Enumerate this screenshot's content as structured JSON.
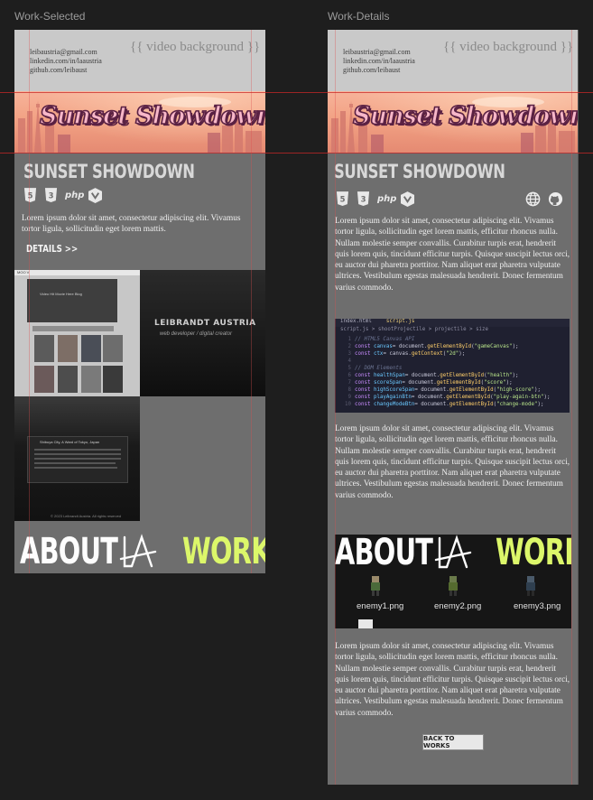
{
  "frames": [
    {
      "label": "Work-Selected",
      "contact": [
        "leibaustria@gmail.com",
        "linkedin.com/in/laaustria",
        "github.com/leibaust"
      ],
      "video_bg": "{{ video background }}",
      "banner_title": "Sunset Showdown",
      "project_title": "SUNSET SHOWDOWN",
      "tech_icons": [
        "html5-icon",
        "css3-icon",
        "php-icon",
        "redux-icon"
      ],
      "php_label": "php",
      "description": "Lorem ipsum dolor sit amet, consectetur adipiscing elit. Vivamus tortor ligula, sollicitudin eget lorem mattis.",
      "details_link": "DETAILS >>",
      "gallery": {
        "item1": {
          "menu": "MOO V",
          "hero": "Video Hit Movie Here Blog"
        },
        "item2": {
          "name": "LEIBRANDT AUSTRIA",
          "tagline": "web developer / digital creator"
        },
        "item3": {
          "title": "Shibuya City, A Ward of Tokyo, Japan",
          "footer": "© 2023 Leibrandt Austria. All rights reserved"
        }
      },
      "nav_words": {
        "about": "ABOUT",
        "work": "WORK"
      }
    },
    {
      "label": "Work-Details",
      "contact": [
        "leibaustria@gmail.com",
        "linkedin.com/in/laaustria",
        "github.com/leibaust"
      ],
      "video_bg": "{{ video background }}",
      "banner_title": "Sunset Showdown",
      "project_title": "SUNSET SHOWDOWN",
      "tech_icons": [
        "html5-icon",
        "css3-icon",
        "php-icon",
        "redux-icon"
      ],
      "php_label": "php",
      "link_icons": [
        "globe-icon",
        "github-icon"
      ],
      "paragraphs": [
        "Lorem ipsum dolor sit amet, consectetur adipiscing elit. Vivamus tortor ligula, sollicitudin eget lorem mattis, efficitur rhoncus nulla. Nullam molestie semper convallis. Curabitur turpis erat, hendrerit quis lorem quis, tincidunt efficitur turpis. Quisque suscipit lectus orci, eu auctor dui pharetra porttitor. Nam aliquet erat pharetra vulputate ultrices. Vestibulum egestas malesuada hendrerit. Donec fermentum varius commodo.",
        "Lorem ipsum dolor sit amet, consectetur adipiscing elit. Vivamus tortor ligula, sollicitudin eget lorem mattis, efficitur rhoncus nulla. Nullam molestie semper convallis. Curabitur turpis erat, hendrerit quis lorem quis, tincidunt efficitur turpis. Quisque suscipit lectus orci, eu auctor dui pharetra porttitor. Nam aliquet erat pharetra vulputate ultrices. Vestibulum egestas malesuada hendrerit. Donec fermentum varius commodo.",
        "Lorem ipsum dolor sit amet, consectetur adipiscing elit. Vivamus tortor ligula, sollicitudin eget lorem mattis, efficitur rhoncus nulla. Nullam molestie semper convallis. Curabitur turpis erat, hendrerit quis lorem quis, tincidunt efficitur turpis. Quisque suscipit lectus orci, eu auctor dui pharetra porttitor. Nam aliquet erat pharetra vulputate ultrices. Vestibulum egestas malesuada hendrerit. Donec fermentum varius commodo."
      ],
      "code": {
        "tabs": [
          "index.html",
          "script.js"
        ],
        "breadcrumb": "script.js > shootProjectile > projectile > size",
        "line_numbers": [
          "1",
          "2",
          "3",
          "4",
          "5",
          "6",
          "7",
          "8",
          "9",
          "10",
          "11"
        ],
        "lines": [
          {
            "parts": [
              [
                "cm",
                "// HTML5 Canvas API"
              ]
            ]
          },
          {
            "parts": [
              [
                "kw",
                "const "
              ],
              [
                "vr",
                "canvas"
              ],
              [
                "",
                "= document."
              ],
              [
                "fn",
                "getElementById"
              ],
              [
                "",
                "("
              ],
              [
                "st",
                "\"gameCanvas\""
              ],
              [
                "",
                ");"
              ]
            ]
          },
          {
            "parts": [
              [
                "kw",
                "const "
              ],
              [
                "vr",
                "ctx"
              ],
              [
                "",
                "= canvas."
              ],
              [
                "fn",
                "getContext"
              ],
              [
                "",
                "("
              ],
              [
                "st",
                "\"2d\""
              ],
              [
                "",
                ");"
              ]
            ]
          },
          {
            "parts": [
              [
                "",
                ""
              ]
            ]
          },
          {
            "parts": [
              [
                "cm",
                "// DOM Elements"
              ]
            ]
          },
          {
            "parts": [
              [
                "kw",
                "const "
              ],
              [
                "vr",
                "healthSpan"
              ],
              [
                "",
                "= document."
              ],
              [
                "fn",
                "getElementById"
              ],
              [
                "",
                "("
              ],
              [
                "st",
                "\"health\""
              ],
              [
                "",
                ");"
              ]
            ]
          },
          {
            "parts": [
              [
                "kw",
                "const "
              ],
              [
                "vr",
                "scoreSpan"
              ],
              [
                "",
                "= document."
              ],
              [
                "fn",
                "getElementById"
              ],
              [
                "",
                "("
              ],
              [
                "st",
                "\"score\""
              ],
              [
                "",
                ");"
              ]
            ]
          },
          {
            "parts": [
              [
                "kw",
                "const "
              ],
              [
                "vr",
                "highScoreSpan"
              ],
              [
                "",
                "= document."
              ],
              [
                "fn",
                "getElementById"
              ],
              [
                "",
                "("
              ],
              [
                "st",
                "\"high-score\""
              ],
              [
                "",
                ");"
              ]
            ]
          },
          {
            "parts": [
              [
                "kw",
                "const "
              ],
              [
                "vr",
                "playAgainBtn"
              ],
              [
                "",
                "= document."
              ],
              [
                "fn",
                "getElementById"
              ],
              [
                "",
                "("
              ],
              [
                "st",
                "\"play-again-btn\""
              ],
              [
                "",
                ");"
              ]
            ]
          },
          {
            "parts": [
              [
                "kw",
                "const "
              ],
              [
                "vr",
                "changeModeBtn"
              ],
              [
                "",
                "= document."
              ],
              [
                "fn",
                "getElementById"
              ],
              [
                "",
                "("
              ],
              [
                "st",
                "\"change-mode\""
              ],
              [
                "",
                ");"
              ]
            ]
          }
        ]
      },
      "nav_words": {
        "about": "ABOUT",
        "work": "WORK"
      },
      "sprites": [
        "enemy1.png",
        "enemy2.png",
        "enemy3.png"
      ],
      "back_button": "BACK TO WORKS"
    }
  ],
  "colors": {
    "canvas": "#1e1e1e",
    "frame": "#6e6e6e",
    "accent_work": "#dcf76a",
    "banner": "#f2a284",
    "banner_text": "#f7b7c8"
  }
}
